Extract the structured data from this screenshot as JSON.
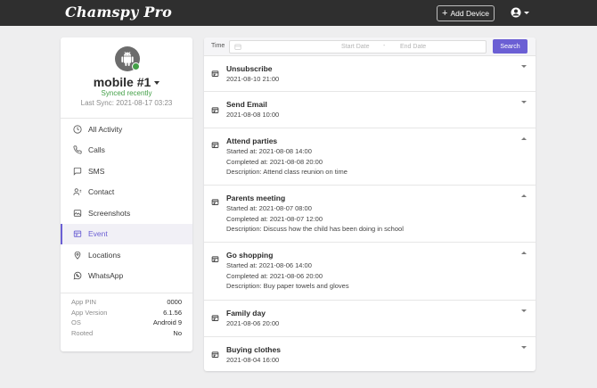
{
  "header": {
    "logo": "Chamspy Pro",
    "add_device_label": "Add Device"
  },
  "device": {
    "name": "mobile #1",
    "sync_status": "Synced recently",
    "last_sync": "Last Sync: 2021-08-17 03:23"
  },
  "nav": [
    {
      "label": "All Activity",
      "icon": "clock-icon"
    },
    {
      "label": "Calls",
      "icon": "phone-icon"
    },
    {
      "label": "SMS",
      "icon": "message-icon"
    },
    {
      "label": "Contact",
      "icon": "contact-icon"
    },
    {
      "label": "Screenshots",
      "icon": "image-icon"
    },
    {
      "label": "Event",
      "icon": "event-icon",
      "active": true
    },
    {
      "label": "Locations",
      "icon": "location-pin-icon"
    },
    {
      "label": "WhatsApp",
      "icon": "whatsapp-icon"
    }
  ],
  "info": [
    {
      "key": "App PIN",
      "value": "0000"
    },
    {
      "key": "App Version",
      "value": "6.1.56"
    },
    {
      "key": "OS",
      "value": "Android 9"
    },
    {
      "key": "Rooted",
      "value": "No"
    }
  ],
  "filter": {
    "time_label": "Time",
    "start_placeholder": "Start Date",
    "separator": "-",
    "end_placeholder": "End Date",
    "search_label": "Search"
  },
  "events": [
    {
      "title": "Unsubscribe",
      "lines": [
        "2021-08-10 21:00"
      ],
      "expanded": false
    },
    {
      "title": "Send Email",
      "lines": [
        "2021-08-08 10:00"
      ],
      "expanded": false
    },
    {
      "title": "Attend parties",
      "lines": [
        "Started at: 2021-08-08 14:00",
        "Completed at: 2021-08-08 20:00",
        "Description: Attend class reunion on time"
      ],
      "expanded": true
    },
    {
      "title": "Parents meeting",
      "lines": [
        "Started at: 2021-08-07 08:00",
        "Completed at: 2021-08-07 12:00",
        "Description: Discuss how the child has been doing in school"
      ],
      "expanded": true
    },
    {
      "title": "Go shopping",
      "lines": [
        "Started at: 2021-08-06 14:00",
        "Completed at: 2021-08-06 20:00",
        "Description: Buy paper towels and gloves"
      ],
      "expanded": true
    },
    {
      "title": "Family day",
      "lines": [
        "2021-08-06 20:00"
      ],
      "expanded": false
    },
    {
      "title": "Buying clothes",
      "lines": [
        "2021-08-04 16:00"
      ],
      "expanded": false
    }
  ],
  "colors": {
    "accent": "#6b5fd4",
    "topbar": "#2f2f2f",
    "synced": "#43a047"
  }
}
